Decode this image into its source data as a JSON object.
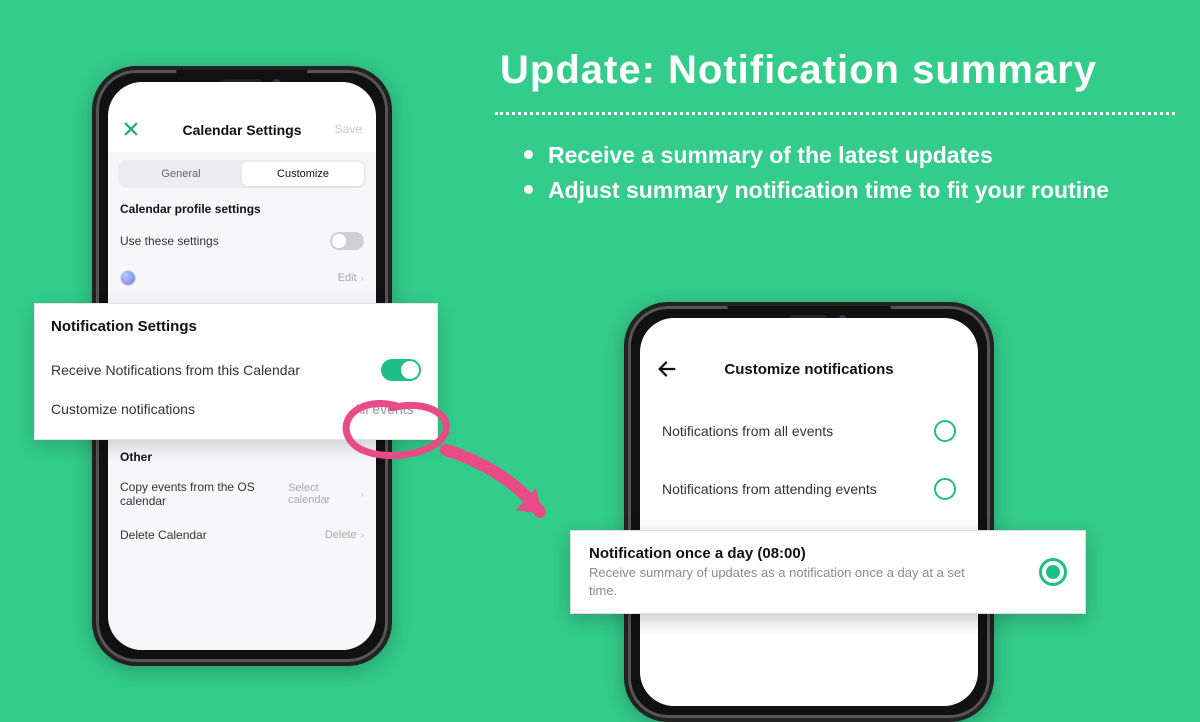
{
  "headline": "Update: Notification summary",
  "bullets": [
    "Receive a summary of the latest updates",
    "Adjust summary notification time to fit your routine"
  ],
  "phone_left": {
    "title": "Calendar Settings",
    "save": "Save",
    "tabs": {
      "general": "General",
      "customize": "Customize"
    },
    "section_profile": "Calendar profile settings",
    "use_these": "Use these settings",
    "edit": "Edit",
    "section_other": "Other",
    "copy_events": "Copy events from the OS calendar",
    "copy_events_value": "Select calendar",
    "delete_cal": "Delete Calendar",
    "delete_value": "Delete"
  },
  "notif_card": {
    "title": "Notification Settings",
    "receive": "Receive Notifications from this Calendar",
    "customize": "Customize notifications",
    "customize_value": "All events"
  },
  "phone_right": {
    "title": "Customize notifications",
    "opt1": "Notifications from all events",
    "opt2": "Notifications from attending events"
  },
  "daily_card": {
    "title": "Notification once a day (08:00)",
    "desc": "Receive summary of updates as a notification once a day at a set time."
  }
}
